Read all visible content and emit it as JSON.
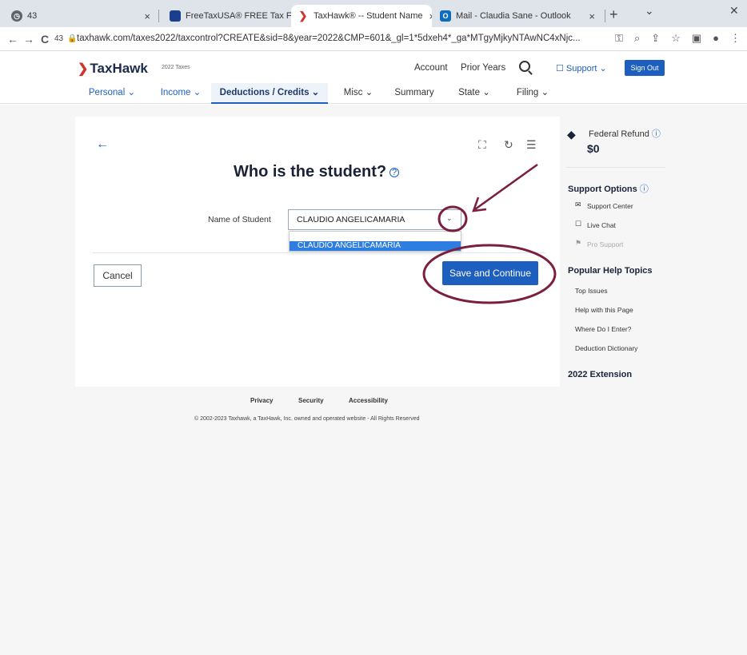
{
  "browser": {
    "tabs": [
      {
        "label": "43",
        "close": "×"
      },
      {
        "label": "FreeTaxUSA® FREE Tax Filing,",
        "close": "×"
      },
      {
        "label": "TaxHawk® -- Student Name",
        "close": "×"
      },
      {
        "label": "Mail - Claudia Sane - Outlook",
        "close": "×"
      }
    ],
    "new_tab": "+",
    "window_controls": {
      "minimize": "⌄",
      "close": "✕"
    },
    "nav": {
      "back": "←",
      "forward": "→",
      "reload": "C",
      "counter": "43"
    },
    "url": "taxhawk.com/taxes2022/taxcontrol?CREATE&sid=8&year=2022&CMP=601&_gl=1*5dxeh4*_ga*MTgyMjkyNTAwNC4xNjc..."
  },
  "header": {
    "logo": "TaxHawk",
    "tax_year": "2022 Taxes",
    "account": "Account",
    "prior_years": "Prior Years",
    "support": "Support",
    "sign_out": "Sign Out"
  },
  "nav": {
    "items": [
      "Personal",
      "Income",
      "Deductions / Credits",
      "Misc",
      "Summary",
      "State",
      "Filing"
    ],
    "active": "Deductions / Credits"
  },
  "question": {
    "title": "Who is the student?",
    "field_label": "Name of Student",
    "selected_value": "CLAUDIO ANGELICAMARIA",
    "dropdown_options": [
      "CLAUDIO ANGELICAMARIA"
    ]
  },
  "buttons": {
    "cancel": "Cancel",
    "save": "Save and Continue"
  },
  "sidebar": {
    "refund_label": "Federal Refund",
    "refund_value": "$0",
    "support_title": "Support Options",
    "support_links": [
      "Support Center",
      "Live Chat",
      "Pro Support"
    ],
    "help_title": "Popular Help Topics",
    "help_links": [
      "Top Issues",
      "Help with this Page",
      "Where Do I Enter?",
      "Deduction Dictionary"
    ],
    "extension": "2022 Extension"
  },
  "footer": {
    "links": [
      "Privacy",
      "Security",
      "Accessibility"
    ],
    "copyright": "© 2002-2023 Taxhawk, a TaxHawk, Inc. owned and operated website - All Rights Reserved"
  },
  "colors": {
    "accent": "#1d5fbf",
    "annotation": "#7a1f3d",
    "brand_red": "#d0342c"
  }
}
